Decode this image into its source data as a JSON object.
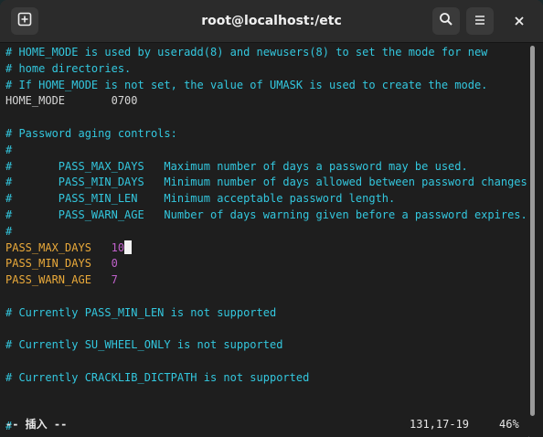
{
  "window": {
    "title": "root@localhost:/etc"
  },
  "icons": {
    "new_tab": "new-tab-icon",
    "search": "search-icon",
    "menu": "hamburger-menu-icon",
    "close": "close-icon"
  },
  "colors": {
    "comment": "#33c7de",
    "key": "#e9a93a",
    "value": "#c061cb",
    "text": "#d6d6d6",
    "background": "#1e1e1e"
  },
  "lines": [
    {
      "parts": [
        {
          "text": "# HOME_MODE is used by useradd(8) and newusers(8) to set the mode for new",
          "cls": "c-comment"
        }
      ]
    },
    {
      "parts": [
        {
          "text": "# home directories.",
          "cls": "c-comment"
        }
      ]
    },
    {
      "parts": [
        {
          "text": "# If HOME_MODE is not set, the value of UMASK is used to create the mode.",
          "cls": "c-comment"
        }
      ]
    },
    {
      "parts": [
        {
          "text": "HOME_MODE       0700",
          "cls": "c-plain"
        }
      ]
    },
    {
      "parts": []
    },
    {
      "parts": [
        {
          "text": "# Password aging controls:",
          "cls": "c-comment"
        }
      ]
    },
    {
      "parts": [
        {
          "text": "#",
          "cls": "c-comment"
        }
      ]
    },
    {
      "parts": [
        {
          "text": "#       PASS_MAX_DAYS   Maximum number of days a password may be used.",
          "cls": "c-comment"
        }
      ]
    },
    {
      "parts": [
        {
          "text": "#       PASS_MIN_DAYS   Minimum number of days allowed between password changes.",
          "cls": "c-comment"
        }
      ]
    },
    {
      "parts": [
        {
          "text": "#       PASS_MIN_LEN    Minimum acceptable password length.",
          "cls": "c-comment"
        }
      ]
    },
    {
      "parts": [
        {
          "text": "#       PASS_WARN_AGE   Number of days warning given before a password expires.",
          "cls": "c-comment"
        }
      ]
    },
    {
      "parts": [
        {
          "text": "#",
          "cls": "c-comment"
        }
      ]
    },
    {
      "parts": [
        {
          "text": "PASS_MAX_DAYS   ",
          "cls": "c-key"
        },
        {
          "text": "10",
          "cls": "c-val"
        }
      ],
      "cursor": true
    },
    {
      "parts": [
        {
          "text": "PASS_MIN_DAYS   ",
          "cls": "c-key"
        },
        {
          "text": "0",
          "cls": "c-val"
        }
      ]
    },
    {
      "parts": [
        {
          "text": "PASS_WARN_AGE   ",
          "cls": "c-key"
        },
        {
          "text": "7",
          "cls": "c-val"
        }
      ]
    },
    {
      "parts": []
    },
    {
      "parts": [
        {
          "text": "# Currently PASS_MIN_LEN is not supported",
          "cls": "c-comment"
        }
      ]
    },
    {
      "parts": []
    },
    {
      "parts": [
        {
          "text": "# Currently SU_WHEEL_ONLY is not supported",
          "cls": "c-comment"
        }
      ]
    },
    {
      "parts": []
    },
    {
      "parts": [
        {
          "text": "# Currently CRACKLIB_DICTPATH is not supported",
          "cls": "c-comment"
        }
      ]
    },
    {
      "parts": []
    },
    {
      "parts": []
    },
    {
      "parts": [
        {
          "text": "#",
          "cls": "c-comment"
        }
      ]
    }
  ],
  "status": {
    "mode": "-- 插入 --",
    "position": "131,17-19",
    "percent": "46%"
  }
}
